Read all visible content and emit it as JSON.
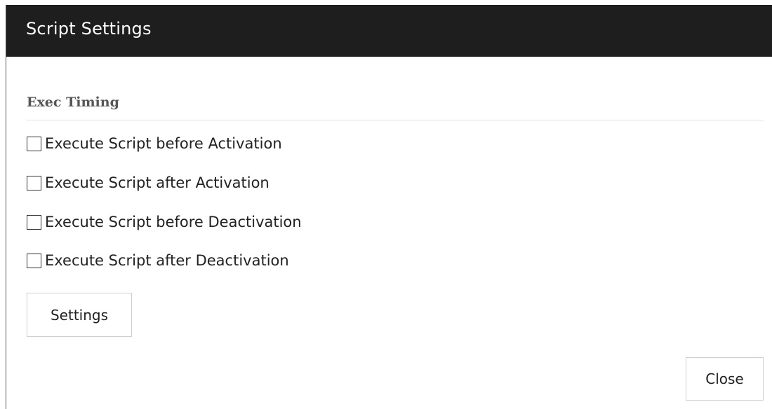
{
  "dialog": {
    "title": "Script Settings"
  },
  "exec_timing": {
    "heading": "Exec Timing",
    "options": [
      {
        "label": "Execute Script before Activation",
        "checked": false
      },
      {
        "label": "Execute Script after Activation",
        "checked": false
      },
      {
        "label": "Execute Script before Deactivation",
        "checked": false
      },
      {
        "label": "Execute Script after Deactivation",
        "checked": false
      }
    ]
  },
  "buttons": {
    "settings_label": "Settings",
    "close_label": "Close"
  },
  "colors": {
    "titlebar_bg": "#1e1e1e",
    "titlebar_text": "#ffffff",
    "heading_text": "#555555",
    "button_border": "#cfcfcf"
  }
}
